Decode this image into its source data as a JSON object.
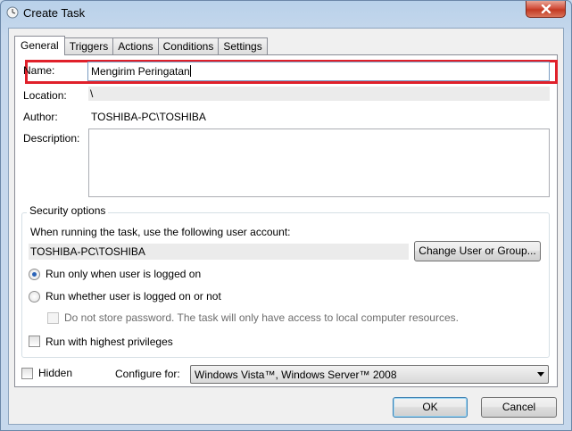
{
  "window": {
    "title": "Create Task"
  },
  "tabs": [
    {
      "label": "General"
    },
    {
      "label": "Triggers"
    },
    {
      "label": "Actions"
    },
    {
      "label": "Conditions"
    },
    {
      "label": "Settings"
    }
  ],
  "general": {
    "name_label": "Name:",
    "name_value": "Mengirim Peringatan",
    "location_label": "Location:",
    "location_value": "\\",
    "author_label": "Author:",
    "author_value": "TOSHIBA-PC\\TOSHIBA",
    "description_label": "Description:",
    "description_value": ""
  },
  "security": {
    "title": "Security options",
    "account_prompt": "When running the task, use the following user account:",
    "account_value": "TOSHIBA-PC\\TOSHIBA",
    "change_button": "Change User or Group...",
    "radio_logged_on": "Run only when user is logged on",
    "radio_logged_on_selected": true,
    "radio_whether": "Run whether user is logged on or not",
    "no_store_password": "Do not store password.  The task will only have access to local computer resources.",
    "highest_privileges": "Run with highest privileges"
  },
  "footer": {
    "hidden_label": "Hidden",
    "configure_label": "Configure for:",
    "configure_value": "Windows Vista™, Windows Server™ 2008"
  },
  "buttons": {
    "ok": "OK",
    "cancel": "Cancel"
  }
}
